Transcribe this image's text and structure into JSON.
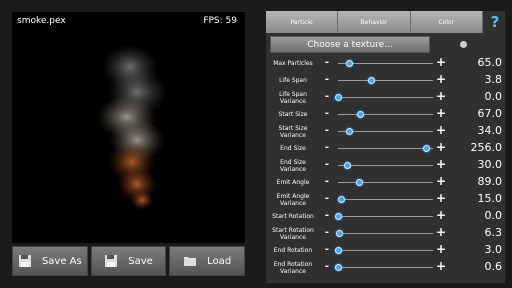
{
  "preview": {
    "filename": "smoke.pex",
    "fps_text": "FPS: 59"
  },
  "buttons": {
    "save_as": "Save As",
    "save": "Save",
    "load": "Load"
  },
  "tabs": [
    "Particle",
    "Behavior",
    "Color"
  ],
  "help_text": "?",
  "texture_button": "Choose a texture...",
  "colors": {
    "accent": "#3aa6ff",
    "help": "#4cc0ff",
    "panel_bg": "#303030"
  },
  "sliders": [
    {
      "label": "Max Particles",
      "value": "65.0",
      "level": 0.12
    },
    {
      "label": "Life Span",
      "value": "3.8",
      "level": 0.35
    },
    {
      "label": "Life Span Variance",
      "value": "0.0",
      "level": 0.0
    },
    {
      "label": "Start Size",
      "value": "67.0",
      "level": 0.24
    },
    {
      "label": "Start Size Variance",
      "value": "34.0",
      "level": 0.12
    },
    {
      "label": "End Size",
      "value": "256.0",
      "level": 0.93
    },
    {
      "label": "End Size Variance",
      "value": "30.0",
      "level": 0.1
    },
    {
      "label": "Emit Angle",
      "value": "89.0",
      "level": 0.23
    },
    {
      "label": "Emit Angle Variance",
      "value": "15.0",
      "level": 0.04
    },
    {
      "label": "Start Rotation",
      "value": "0.0",
      "level": 0.0
    },
    {
      "label": "Start Rotation Variance",
      "value": "6.3",
      "level": 0.02
    },
    {
      "label": "End Rotation",
      "value": "3.0",
      "level": 0.01
    },
    {
      "label": "End Rotation Variance",
      "value": "0.6",
      "level": 0.0
    }
  ]
}
